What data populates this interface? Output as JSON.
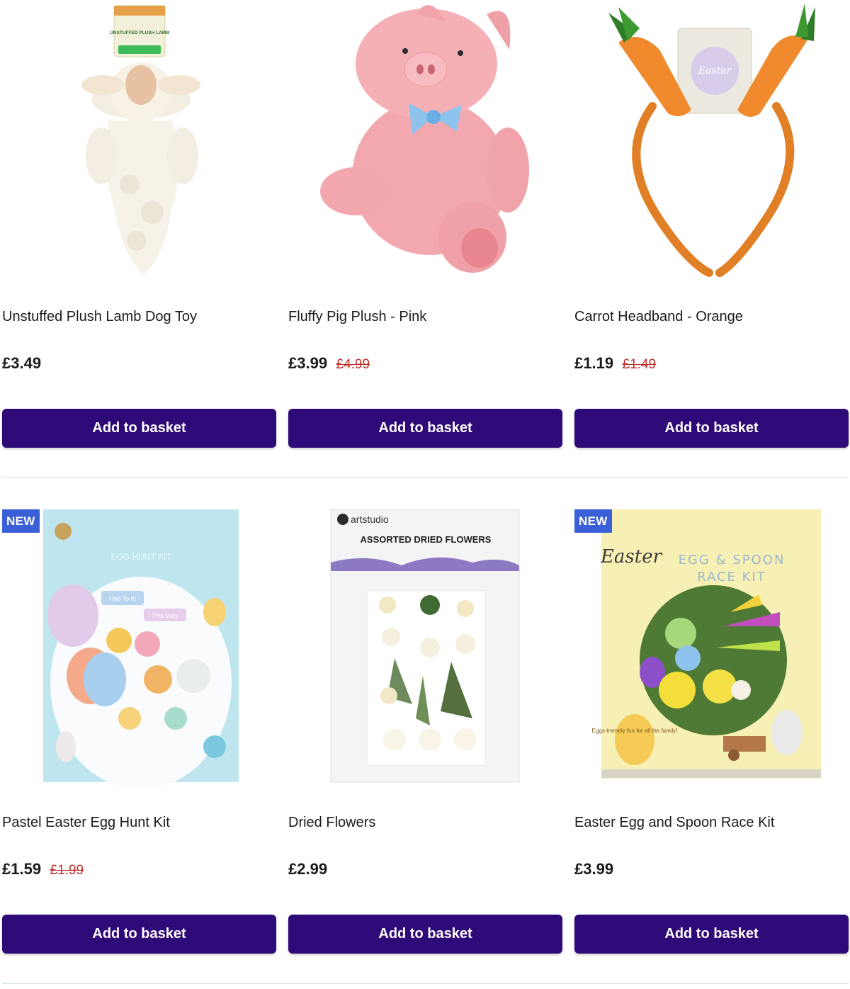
{
  "products": [
    {
      "title": "Unstuffed Plush Lamb Dog Toy",
      "price": "£3.49",
      "old_price": "",
      "badge": "",
      "button_label": "Add to basket",
      "image_tag": "UNSTUFFED PLUSH LAMB"
    },
    {
      "title": "Fluffy Pig Plush - Pink",
      "price": "£3.99",
      "old_price": "£4.99",
      "badge": "",
      "button_label": "Add to basket"
    },
    {
      "title": "Carrot Headband - Orange",
      "price": "£1.19",
      "old_price": "£1.49",
      "badge": "",
      "button_label": "Add to basket",
      "image_tag": "Easter"
    },
    {
      "title": "Pastel Easter Egg Hunt Kit",
      "price": "£1.59",
      "old_price": "£1.99",
      "badge": "NEW",
      "button_label": "Add to basket",
      "image_heading": "EGG HUNT KIT",
      "image_sign_1": "Hop To It!",
      "image_sign_2": "This Way"
    },
    {
      "title": "Dried Flowers",
      "price": "£2.99",
      "old_price": "",
      "badge": "",
      "button_label": "Add to basket",
      "image_brand": "artstudio",
      "image_heading": "ASSORTED DRIED FLOWERS"
    },
    {
      "title": "Easter Egg and Spoon Race Kit",
      "price": "£3.99",
      "old_price": "",
      "badge": "NEW",
      "button_label": "Add to basket",
      "image_script": "Easter",
      "image_heading_1": "EGG & SPOON",
      "image_heading_2": "RACE KIT",
      "image_tagline": "Eggs-tremely fun for all the family!"
    }
  ],
  "colors": {
    "button": "#2d0a78",
    "badge": "#3a5fd6",
    "old_price": "#c0302b",
    "divider": "#cfdde6"
  }
}
